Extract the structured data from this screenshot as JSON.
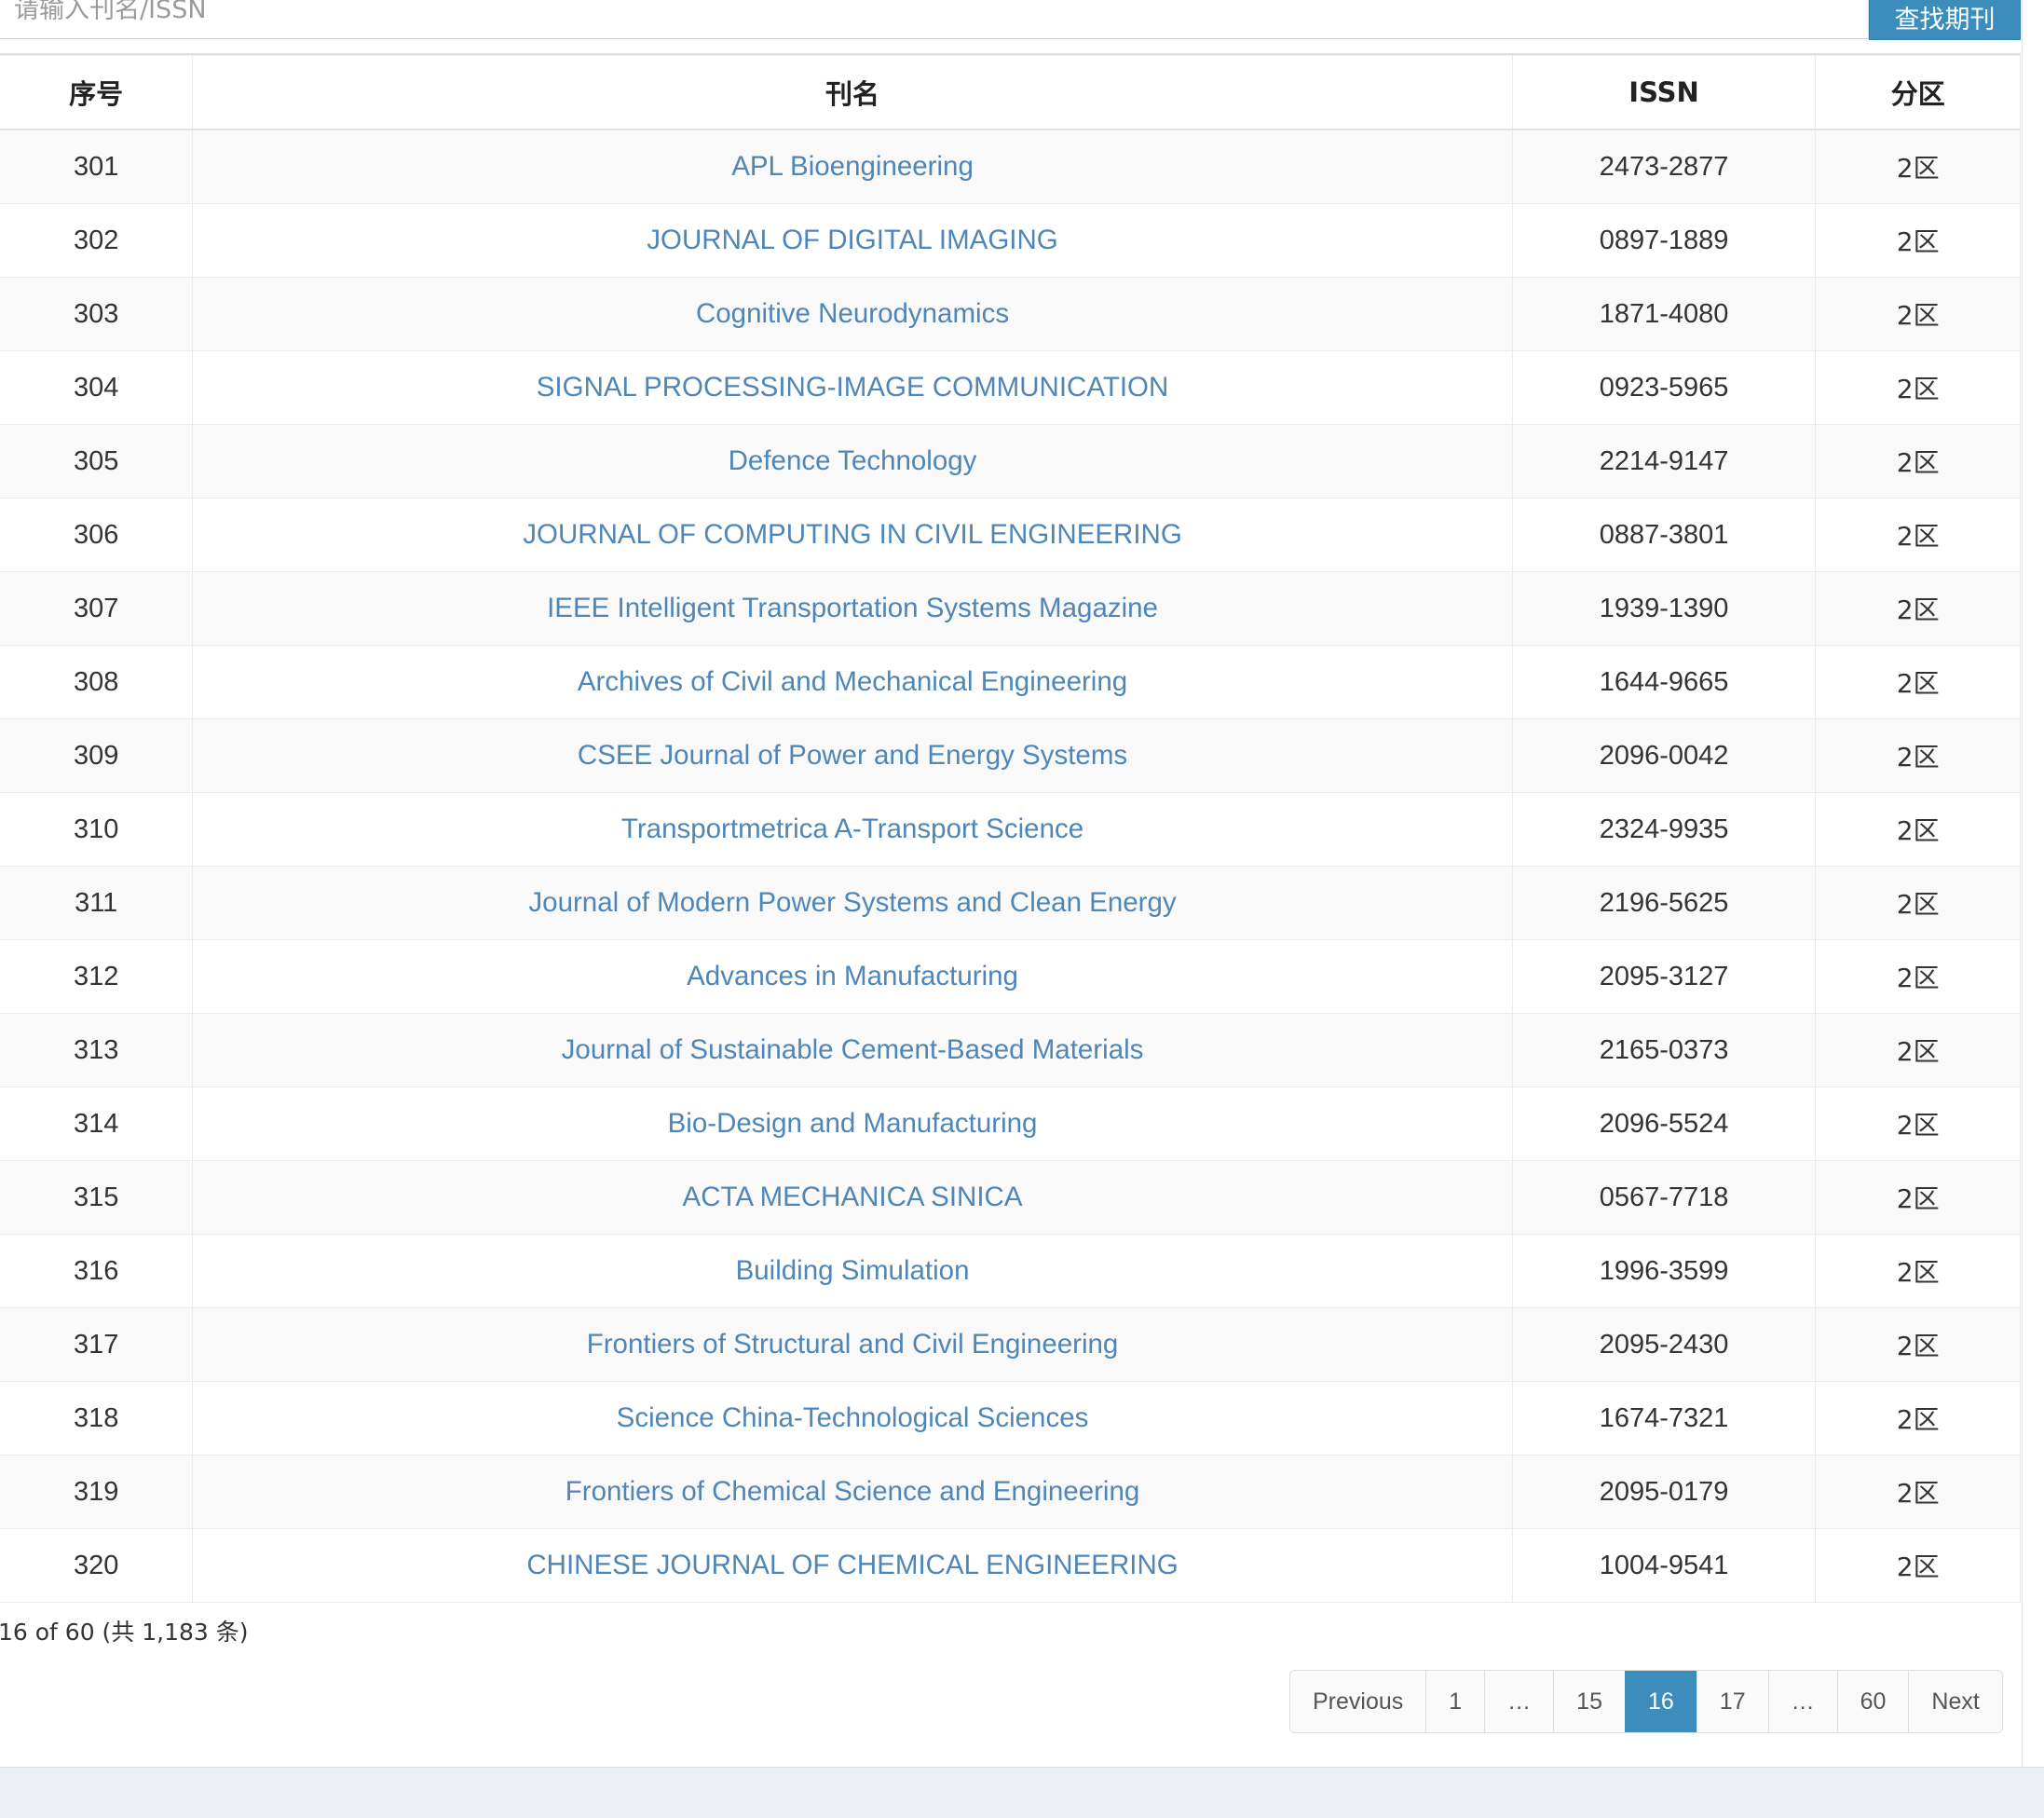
{
  "search": {
    "placeholder": "请输入刊名/ISSN",
    "button_label": "查找期刊"
  },
  "table": {
    "headers": {
      "index": "序号",
      "name": "刊名",
      "issn": "ISSN",
      "zone": "分区"
    },
    "rows": [
      {
        "index": "301",
        "name": "APL Bioengineering",
        "issn": "2473-2877",
        "zone": "2区"
      },
      {
        "index": "302",
        "name": "JOURNAL OF DIGITAL IMAGING",
        "issn": "0897-1889",
        "zone": "2区"
      },
      {
        "index": "303",
        "name": "Cognitive Neurodynamics",
        "issn": "1871-4080",
        "zone": "2区"
      },
      {
        "index": "304",
        "name": "SIGNAL PROCESSING-IMAGE COMMUNICATION",
        "issn": "0923-5965",
        "zone": "2区"
      },
      {
        "index": "305",
        "name": "Defence Technology",
        "issn": "2214-9147",
        "zone": "2区"
      },
      {
        "index": "306",
        "name": "JOURNAL OF COMPUTING IN CIVIL ENGINEERING",
        "issn": "0887-3801",
        "zone": "2区"
      },
      {
        "index": "307",
        "name": "IEEE Intelligent Transportation Systems Magazine",
        "issn": "1939-1390",
        "zone": "2区"
      },
      {
        "index": "308",
        "name": "Archives of Civil and Mechanical Engineering",
        "issn": "1644-9665",
        "zone": "2区"
      },
      {
        "index": "309",
        "name": "CSEE Journal of Power and Energy Systems",
        "issn": "2096-0042",
        "zone": "2区"
      },
      {
        "index": "310",
        "name": "Transportmetrica A-Transport Science",
        "issn": "2324-9935",
        "zone": "2区"
      },
      {
        "index": "311",
        "name": "Journal of Modern Power Systems and Clean Energy",
        "issn": "2196-5625",
        "zone": "2区"
      },
      {
        "index": "312",
        "name": "Advances in Manufacturing",
        "issn": "2095-3127",
        "zone": "2区"
      },
      {
        "index": "313",
        "name": "Journal of Sustainable Cement-Based Materials",
        "issn": "2165-0373",
        "zone": "2区"
      },
      {
        "index": "314",
        "name": "Bio-Design and Manufacturing",
        "issn": "2096-5524",
        "zone": "2区"
      },
      {
        "index": "315",
        "name": "ACTA MECHANICA SINICA",
        "issn": "0567-7718",
        "zone": "2区"
      },
      {
        "index": "316",
        "name": "Building Simulation",
        "issn": "1996-3599",
        "zone": "2区"
      },
      {
        "index": "317",
        "name": "Frontiers of Structural and Civil Engineering",
        "issn": "2095-2430",
        "zone": "2区"
      },
      {
        "index": "318",
        "name": "Science China-Technological Sciences",
        "issn": "1674-7321",
        "zone": "2区"
      },
      {
        "index": "319",
        "name": "Frontiers of Chemical Science and Engineering",
        "issn": "2095-0179",
        "zone": "2区"
      },
      {
        "index": "320",
        "name": "CHINESE JOURNAL OF CHEMICAL ENGINEERING",
        "issn": "1004-9541",
        "zone": "2区"
      }
    ]
  },
  "page_info": "16 of 60 (共 1,183 条)",
  "pagination": {
    "items": [
      {
        "label": "Previous",
        "active": false
      },
      {
        "label": "1",
        "active": false
      },
      {
        "label": "…",
        "active": false
      },
      {
        "label": "15",
        "active": false
      },
      {
        "label": "16",
        "active": true
      },
      {
        "label": "17",
        "active": false
      },
      {
        "label": "…",
        "active": false
      },
      {
        "label": "60",
        "active": false
      },
      {
        "label": "Next",
        "active": false
      }
    ]
  },
  "colors": {
    "accent": "#3c8dbc",
    "link": "#4f86b8",
    "stripe": "#f9f9f9",
    "footer": "#ecf0f5"
  }
}
